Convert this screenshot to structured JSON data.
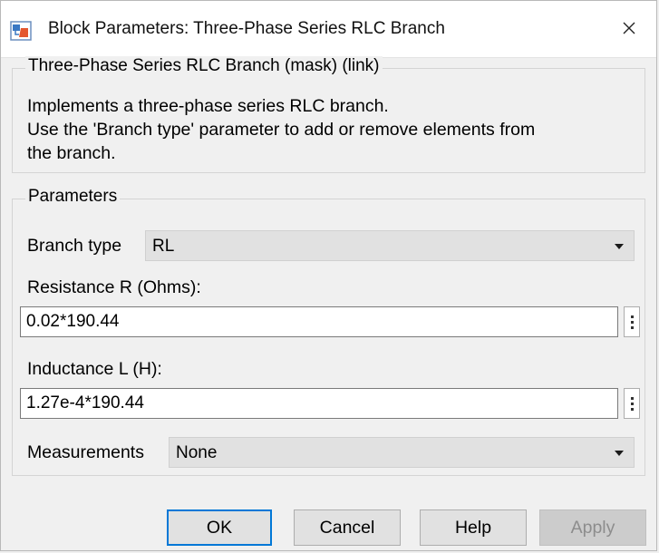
{
  "window": {
    "title": "Block Parameters: Three-Phase Series RLC Branch",
    "app_icon": "simulink-block-icon",
    "close_icon": "close-icon"
  },
  "description": {
    "legend": "Three-Phase Series RLC Branch (mask) (link)",
    "lines": [
      "Implements a three-phase series RLC branch.",
      "Use the 'Branch type' parameter to add or remove elements from",
      "the branch."
    ]
  },
  "parameters": {
    "legend": "Parameters",
    "branch_type": {
      "label": "Branch type",
      "value": "RL"
    },
    "resistance": {
      "label": "Resistance R (Ohms):",
      "value": "0.02*190.44"
    },
    "inductance": {
      "label": "Inductance L (H):",
      "value": "1.27e-4*190.44"
    },
    "measurements": {
      "label": "Measurements",
      "value": "None"
    }
  },
  "buttons": {
    "ok": "OK",
    "cancel": "Cancel",
    "help": "Help",
    "apply": "Apply"
  },
  "colors": {
    "focus_border": "#0078d7",
    "disabled_text": "#8d8d8d"
  }
}
